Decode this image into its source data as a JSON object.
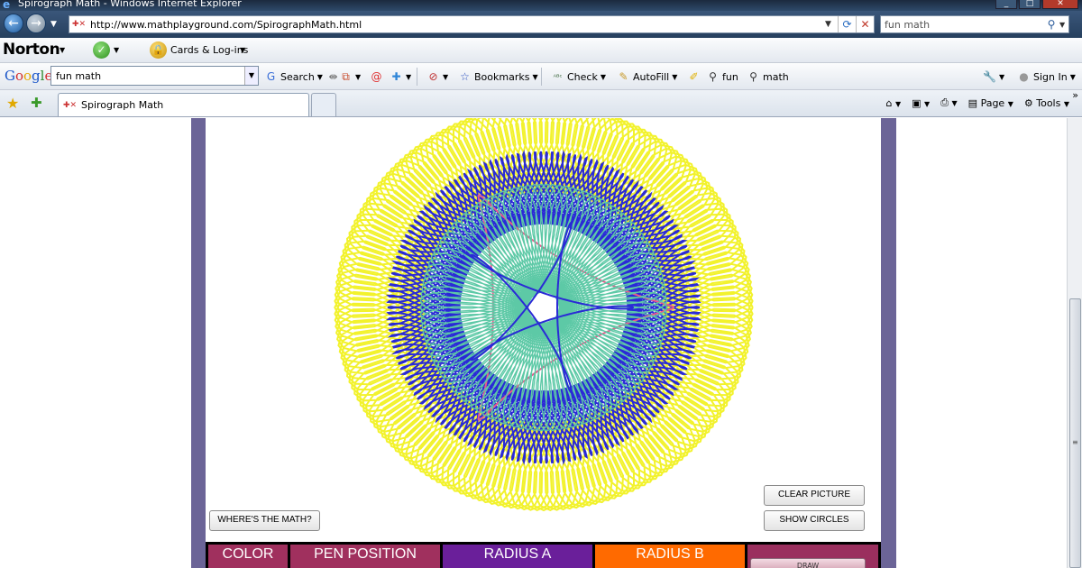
{
  "window": {
    "title": "Spirograph Math - Windows Internet Explorer",
    "address_url": "http://www.mathplayground.com/SpirographMath.html",
    "search_value": "fun math"
  },
  "norton_toolbar": {
    "brand": "Norton",
    "cards_label": "Cards & Log-ins"
  },
  "google_toolbar": {
    "logo": [
      "G",
      "o",
      "o",
      "g",
      "l",
      "e"
    ],
    "query": "fun math",
    "search_label": "Search",
    "bookmarks_label": "Bookmarks",
    "check_label": "Check",
    "autofill_label": "AutoFill",
    "highlight_term_1": "fun",
    "highlight_term_2": "math",
    "sign_in_label": "Sign In"
  },
  "tabs": {
    "active_label": "Spirograph Math",
    "page_label": "Page",
    "tools_label": "Tools"
  },
  "app": {
    "clear_picture": "CLEAR PICTURE",
    "show_circles": "SHOW CIRCLES",
    "wheres_math": "WHERE'S THE MATH?",
    "draw": "DRAW",
    "panel": [
      {
        "label": "COLOR",
        "color": "#a0305e"
      },
      {
        "label": "PEN POSITION",
        "color": "#a0305e"
      },
      {
        "label": "RADIUS A",
        "color": "#6a1f9a"
      },
      {
        "label": "RADIUS B",
        "color": "#ff6a00"
      }
    ],
    "curve_colors": {
      "yellow": "#f2f22c",
      "blue": "#2a2ad6",
      "pink": "#e85a8c",
      "green": "#5dc9a6"
    }
  },
  "colors": {
    "frame": "#6b6497",
    "titlebar": "#1f3450"
  }
}
